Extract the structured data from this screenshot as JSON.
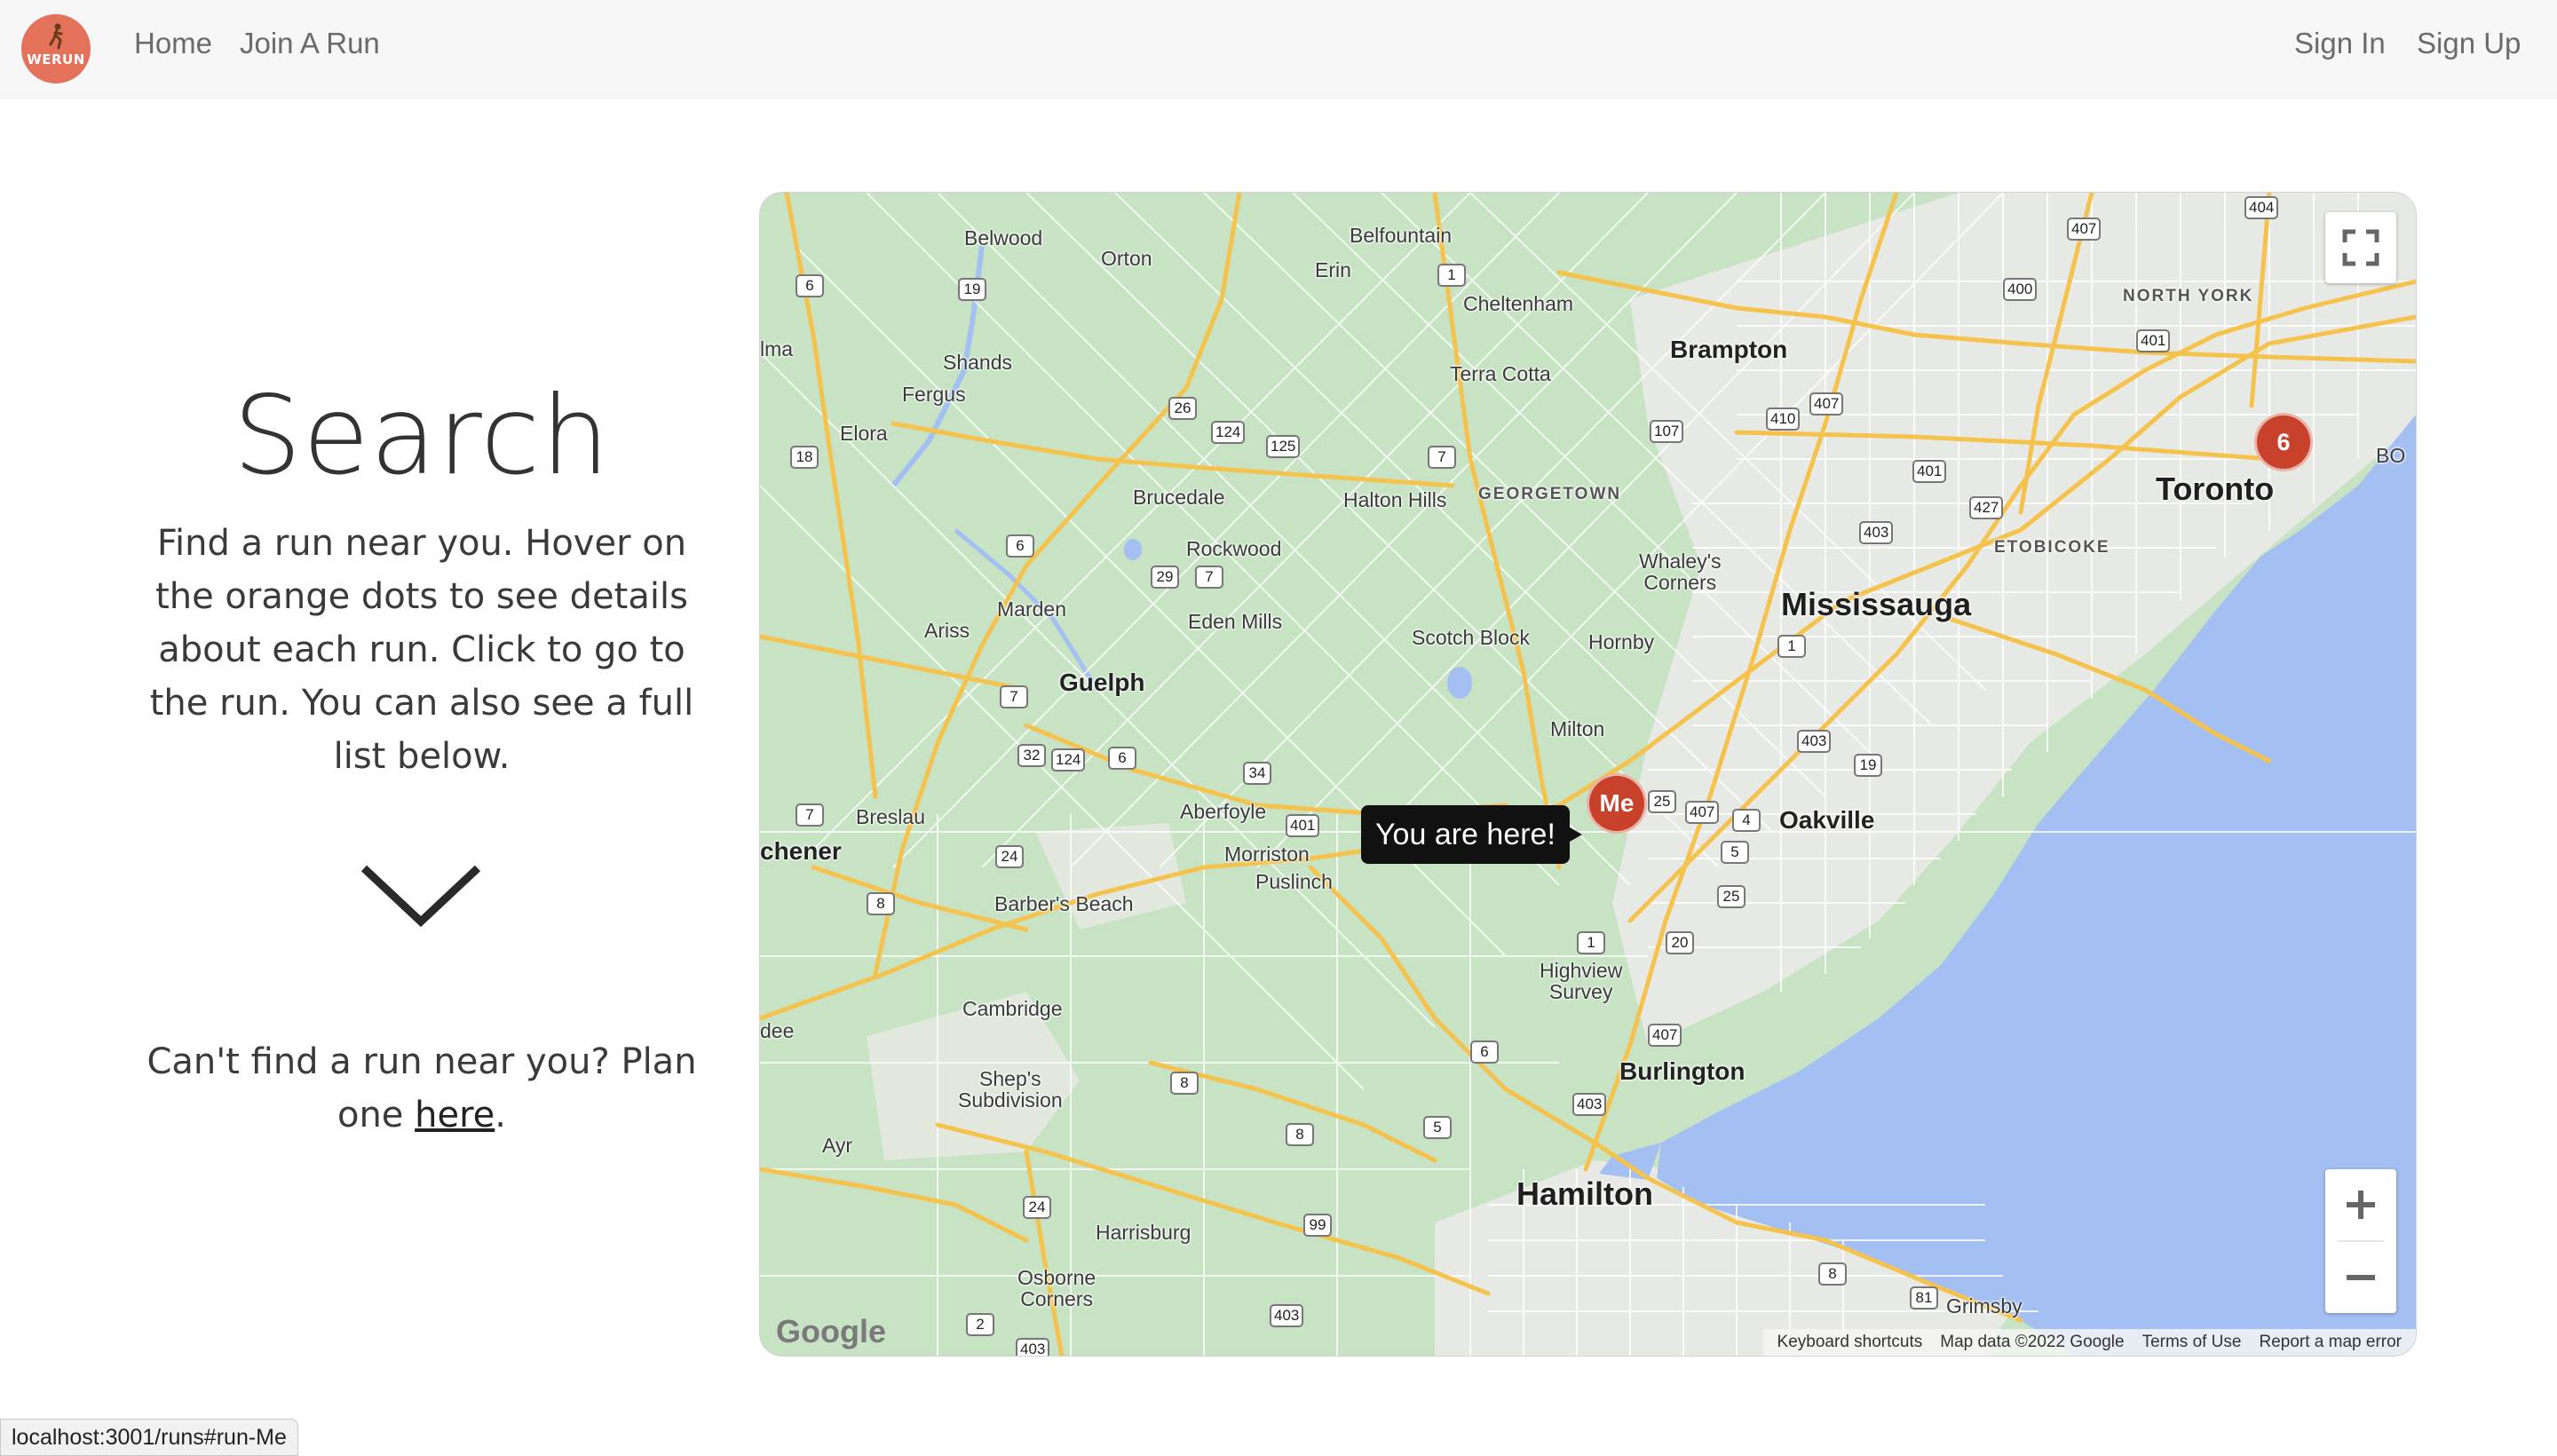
{
  "nav": {
    "logo_text": "WERUN",
    "home": "Home",
    "join": "Join A Run",
    "sign_in": "Sign In",
    "sign_up": "Sign Up"
  },
  "search": {
    "title": "Search",
    "description": "Find a run near you. Hover on the orange dots to see details about each run. Click to go to the run. You can also see a full list below.",
    "plan_prefix": "Can't find a run near you? Plan one ",
    "plan_link": "here",
    "plan_suffix": "."
  },
  "map": {
    "places": {
      "belwood": "Belwood",
      "orton": "Orton",
      "belfountain": "Belfountain",
      "erin": "Erin",
      "cheltenham": "Cheltenham",
      "brampton": "Brampton",
      "north_york": "NORTH YORK",
      "shands": "Shands",
      "fergus": "Fergus",
      "elora": "Elora",
      "terra_cotta": "Terra Cotta",
      "toronto": "Toronto",
      "brucedale": "Brucedale",
      "halton_hills": "Halton Hills",
      "georgetown": "GEORGETOWN",
      "etobicoke": "ETOBICOKE",
      "rockwood": "Rockwood",
      "whaleys": "Whaley's\nCorners",
      "mississauga": "Mississauga",
      "marden": "Marden",
      "ariss": "Ariss",
      "eden_mills": "Eden Mills",
      "scotch_block": "Scotch Block",
      "hornby": "Hornby",
      "guelph": "Guelph",
      "milton": "Milton",
      "breslau": "Breslau",
      "aberfoyle": "Aberfoyle",
      "oakville": "Oakville",
      "kitchener": "chener",
      "morriston": "Morriston",
      "puslinch": "Puslinch",
      "barbers_beach": "Barber's Beach",
      "highview": "Highview\nSurvey",
      "cambridge": "Cambridge",
      "dee": "dee",
      "burlington": "Burlington",
      "sheps": "Shep's\nSubdivision",
      "ayr": "Ayr",
      "hamilton": "Hamilton",
      "harrisburg": "Harrisburg",
      "osborne": "Osborne\nCorners",
      "grimsby": "Grimsby",
      "ilma": "lma",
      "bo": "BO"
    },
    "me_marker": "Me",
    "cluster_count": "6",
    "tooltip": "You are here!",
    "google": "Google",
    "footer": {
      "shortcuts": "Keyboard shortcuts",
      "map_data": "Map data ©2022 Google",
      "terms": "Terms of Use",
      "report": "Report a map error"
    },
    "colors": {
      "land": "#c7e3c3",
      "water": "#a4bff2",
      "urban": "#e9ece6",
      "road": "#f5c24d"
    }
  },
  "status_url": "localhost:3001/runs#run-Me"
}
